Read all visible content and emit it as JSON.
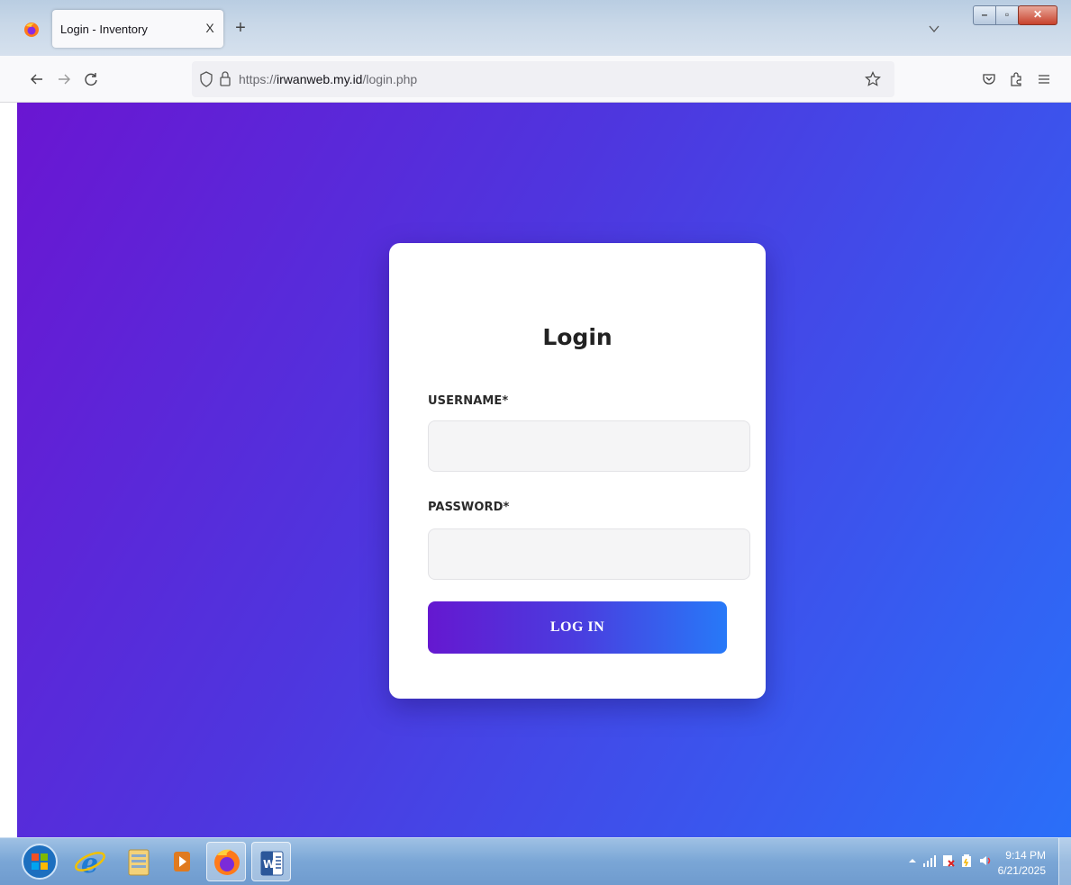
{
  "browser": {
    "tab_title": "Login - Inventory",
    "tab_close": "X",
    "new_tab": "+",
    "url_prefix": "https://",
    "url_host": "irwanweb.my.id",
    "url_path": "/login.php",
    "icons": [
      "firefox-icon",
      "back-icon",
      "forward-icon",
      "reload-icon",
      "shield-icon",
      "lock-icon",
      "star-icon",
      "pocket-icon",
      "extensions-icon",
      "menu-icon",
      "tab-list-icon"
    ]
  },
  "login": {
    "title": "Login",
    "username_label": "USERNAME*",
    "username_value": "",
    "password_label": "PASSWORD*",
    "password_value": "",
    "submit_label": "LOG IN",
    "colors": {
      "gradient_start": "#6518d0",
      "gradient_end": "#2779f8",
      "card": "#ffffff"
    }
  },
  "taskbar": {
    "apps": [
      "start-orb",
      "internet-explorer",
      "file-explorer",
      "media-player",
      "firefox",
      "microsoft-word"
    ],
    "time": "9:14 PM",
    "date": "6/21/2025"
  }
}
